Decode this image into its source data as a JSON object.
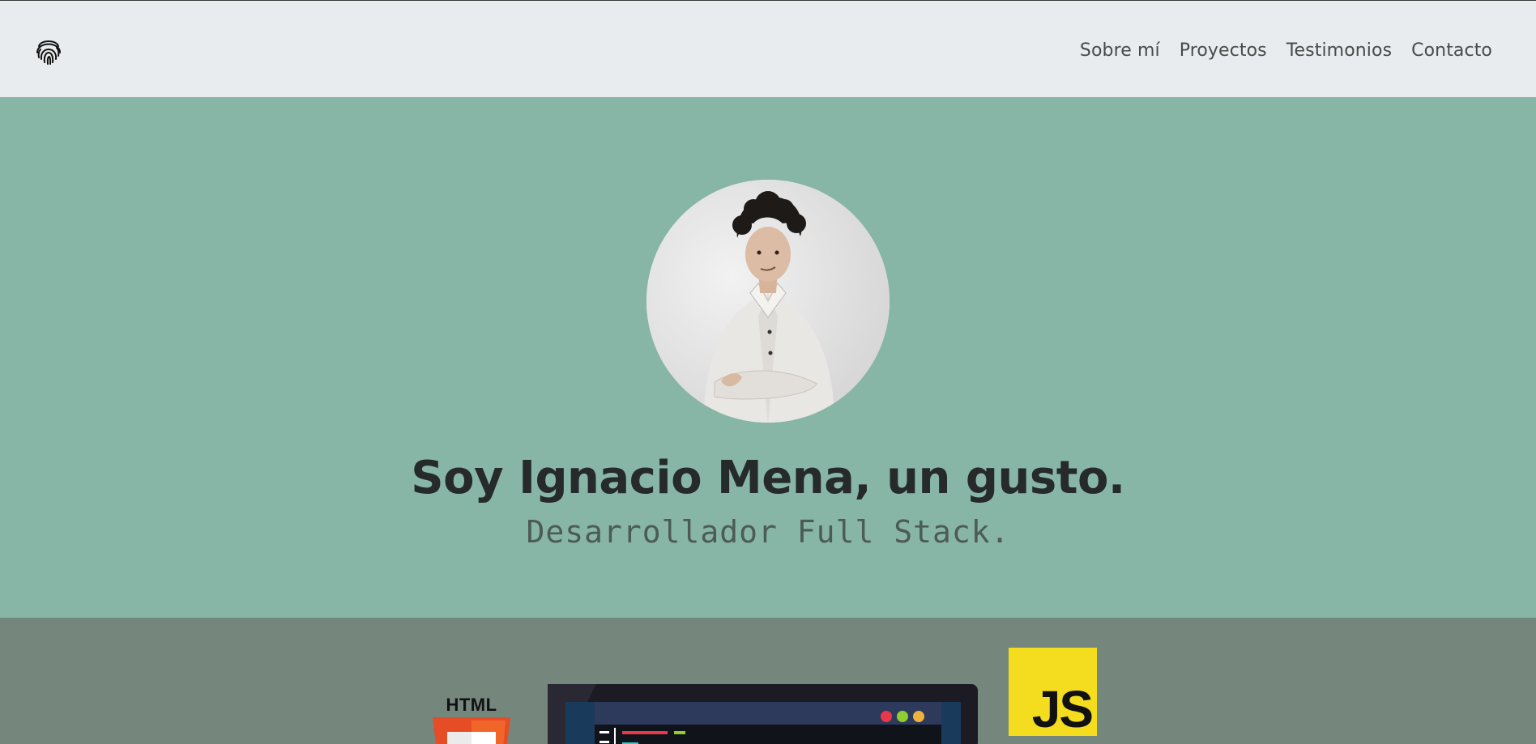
{
  "nav": {
    "logo_icon": "fingerprint-icon",
    "links": [
      "Sobre mí",
      "Proyectos",
      "Testimonios",
      "Contacto"
    ]
  },
  "hero": {
    "title": "Soy Ignacio Mena, un gusto.",
    "subtitle": "Desarrollador Full Stack."
  },
  "skills": {
    "html_label": "HTML",
    "js_label": "JS"
  },
  "colors": {
    "navbar_bg": "#e8ecef",
    "hero_bg": "#87b6a7",
    "skills_bg": "#75867d",
    "html_orange": "#e44d26",
    "js_yellow": "#f4dc1f"
  }
}
